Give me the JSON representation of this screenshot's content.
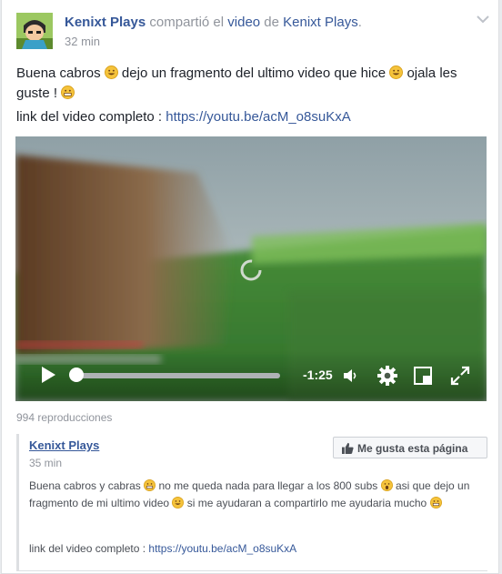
{
  "post": {
    "author": "Kenixt Plays",
    "action_text": "compartió el",
    "object": "video",
    "preposition": "de",
    "source": "Kenixt Plays",
    "period": ".",
    "time": "32 min",
    "message": {
      "part1": "Buena cabros",
      "part2": "dejo un fragmento del ultimo video que hice",
      "part3": "ojala les guste !"
    },
    "link_prefix": "link del video completo :",
    "link_url": "https://youtu.be/acM_o8suKxA"
  },
  "video": {
    "remaining": "-1:25",
    "progress": 0.0
  },
  "views": "994 reproducciones",
  "shared": {
    "author": "Kenixt Plays",
    "time": "35 min",
    "like_page_label": "Me gusta esta página",
    "message": {
      "part1": "Buena cabros y cabras",
      "part2": "no me queda nada para llegar a los 800 subs",
      "part3": "asi que dejo un fragmento de mi ultimo video",
      "part4": "si me ayudaran a compartirlo me ayudaria mucho"
    },
    "link_prefix": "link del video completo :",
    "link_url": "https://youtu.be/acM_o8suKxA"
  },
  "colors": {
    "link": "#365899",
    "meta": "#90949c",
    "emoji": "#f5c33b"
  }
}
